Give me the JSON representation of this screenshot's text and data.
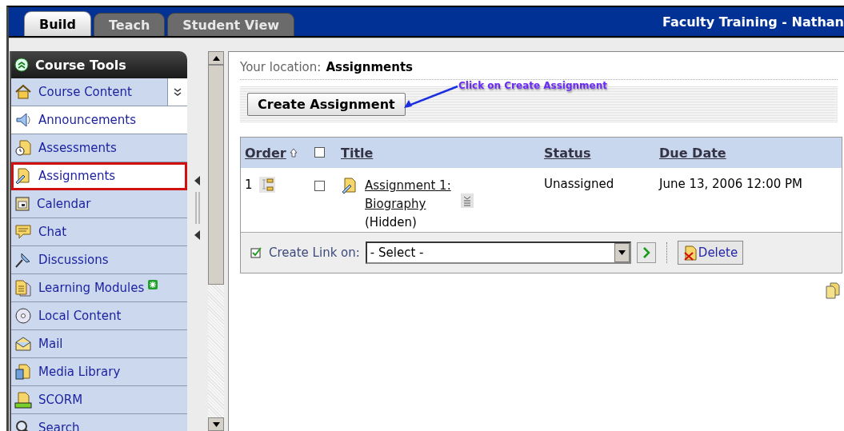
{
  "header": {
    "tabs": [
      {
        "label": "Build",
        "selected": true
      },
      {
        "label": "Teach",
        "selected": false
      },
      {
        "label": "Student View",
        "selected": false
      }
    ],
    "course_title": "Faculty Training - Nathan"
  },
  "sidebar": {
    "title": "Course Tools",
    "items": [
      {
        "label": "Course Content",
        "selected": false,
        "highlighted": false,
        "has_menu": true,
        "new": false
      },
      {
        "label": "Announcements",
        "selected": false,
        "highlighted": true,
        "has_menu": false,
        "new": false
      },
      {
        "label": "Assessments",
        "selected": false,
        "highlighted": false,
        "has_menu": false,
        "new": false
      },
      {
        "label": "Assignments",
        "selected": true,
        "highlighted": false,
        "has_menu": false,
        "new": false
      },
      {
        "label": "Calendar",
        "selected": false,
        "highlighted": false,
        "has_menu": false,
        "new": false
      },
      {
        "label": "Chat",
        "selected": false,
        "highlighted": false,
        "has_menu": false,
        "new": false
      },
      {
        "label": "Discussions",
        "selected": false,
        "highlighted": false,
        "has_menu": false,
        "new": false
      },
      {
        "label": "Learning Modules",
        "selected": false,
        "highlighted": false,
        "has_menu": false,
        "new": true
      },
      {
        "label": "Local Content",
        "selected": false,
        "highlighted": false,
        "has_menu": false,
        "new": false
      },
      {
        "label": "Mail",
        "selected": false,
        "highlighted": false,
        "has_menu": false,
        "new": false
      },
      {
        "label": "Media Library",
        "selected": false,
        "highlighted": false,
        "has_menu": false,
        "new": false
      },
      {
        "label": "SCORM",
        "selected": false,
        "highlighted": false,
        "has_menu": false,
        "new": false
      },
      {
        "label": "Search",
        "selected": false,
        "highlighted": false,
        "has_menu": false,
        "new": false
      }
    ]
  },
  "location": {
    "label": "Your location:",
    "value": "Assignments"
  },
  "toolbar": {
    "button": "Create Assignment"
  },
  "callout": {
    "text": "Click on Create Assignment"
  },
  "table": {
    "header_checkbox": {
      "checked": false
    },
    "columns": [
      {
        "label": "Order",
        "sorted": true
      },
      {
        "label": "Title",
        "sorted": false
      },
      {
        "label": "Status",
        "sorted": false
      },
      {
        "label": "Due Date",
        "sorted": false
      }
    ],
    "rows": [
      {
        "order": "1",
        "checked": false,
        "title": "Assignment 1: Biography",
        "note": "(Hidden)",
        "status": "Unassigned",
        "due_date": "June 13, 2006 12:00 PM"
      }
    ],
    "footer": {
      "label": "Create Link on:",
      "select": "- Select -",
      "delete": "Delete"
    }
  }
}
